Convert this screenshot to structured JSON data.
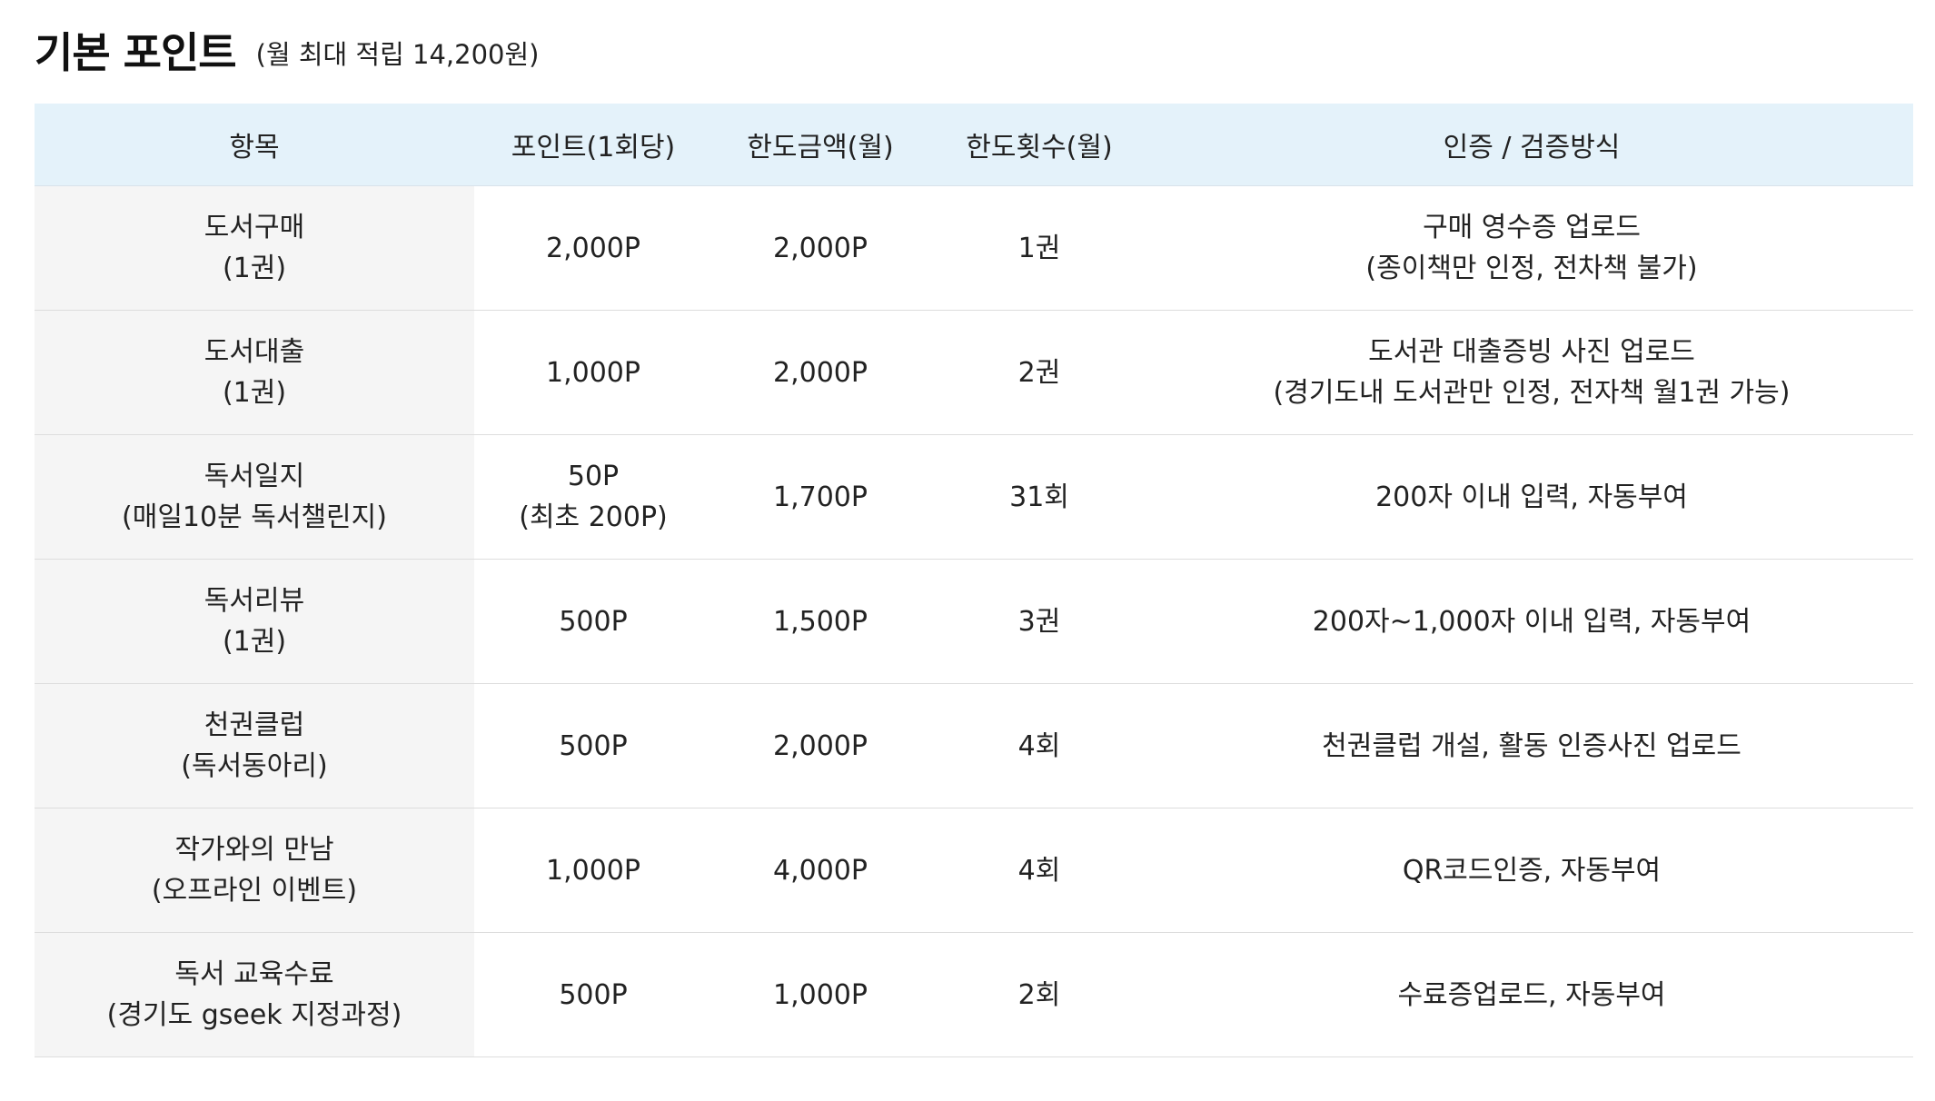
{
  "title": {
    "main": "기본 포인트",
    "sub": "(월 최대 적립 14,200원)"
  },
  "table": {
    "headers": [
      "항목",
      "포인트(1회당)",
      "한도금액(월)",
      "한도횟수(월)",
      "인증 / 검증방식"
    ],
    "rows": [
      {
        "item": [
          "도서구매",
          "(1권)"
        ],
        "points": [
          "2,000P"
        ],
        "limit_amount": "2,000P",
        "limit_count": "1권",
        "method": [
          "구매 영수증 업로드",
          "(종이책만 인정, 전차책 불가)"
        ]
      },
      {
        "item": [
          "도서대출",
          "(1권)"
        ],
        "points": [
          "1,000P"
        ],
        "limit_amount": "2,000P",
        "limit_count": "2권",
        "method": [
          "도서관 대출증빙 사진 업로드",
          "(경기도내 도서관만 인정, 전자책 월1권 가능)"
        ]
      },
      {
        "item": [
          "독서일지",
          "(매일10분 독서챌린지)"
        ],
        "points": [
          "50P",
          "(최초 200P)"
        ],
        "limit_amount": "1,700P",
        "limit_count": "31회",
        "method": [
          "200자 이내 입력, 자동부여"
        ]
      },
      {
        "item": [
          "독서리뷰",
          "(1권)"
        ],
        "points": [
          "500P"
        ],
        "limit_amount": "1,500P",
        "limit_count": "3권",
        "method": [
          "200자~1,000자 이내 입력, 자동부여"
        ]
      },
      {
        "item": [
          "천권클럽",
          "(독서동아리)"
        ],
        "points": [
          "500P"
        ],
        "limit_amount": "2,000P",
        "limit_count": "4회",
        "method": [
          "천권클럽 개설, 활동 인증사진 업로드"
        ]
      },
      {
        "item": [
          "작가와의 만남",
          "(오프라인 이벤트)"
        ],
        "points": [
          "1,000P"
        ],
        "limit_amount": "4,000P",
        "limit_count": "4회",
        "method": [
          "QR코드인증, 자동부여"
        ]
      },
      {
        "item": [
          "독서 교육수료",
          "(경기도 gseek 지정과정)"
        ],
        "points": [
          "500P"
        ],
        "limit_amount": "1,000P",
        "limit_count": "2회",
        "method": [
          "수료증업로드, 자동부여"
        ]
      }
    ]
  },
  "colors": {
    "header_bg": "#e4f2fa",
    "item_col_bg": "#f5f5f5",
    "row_border": "#dddddd"
  }
}
